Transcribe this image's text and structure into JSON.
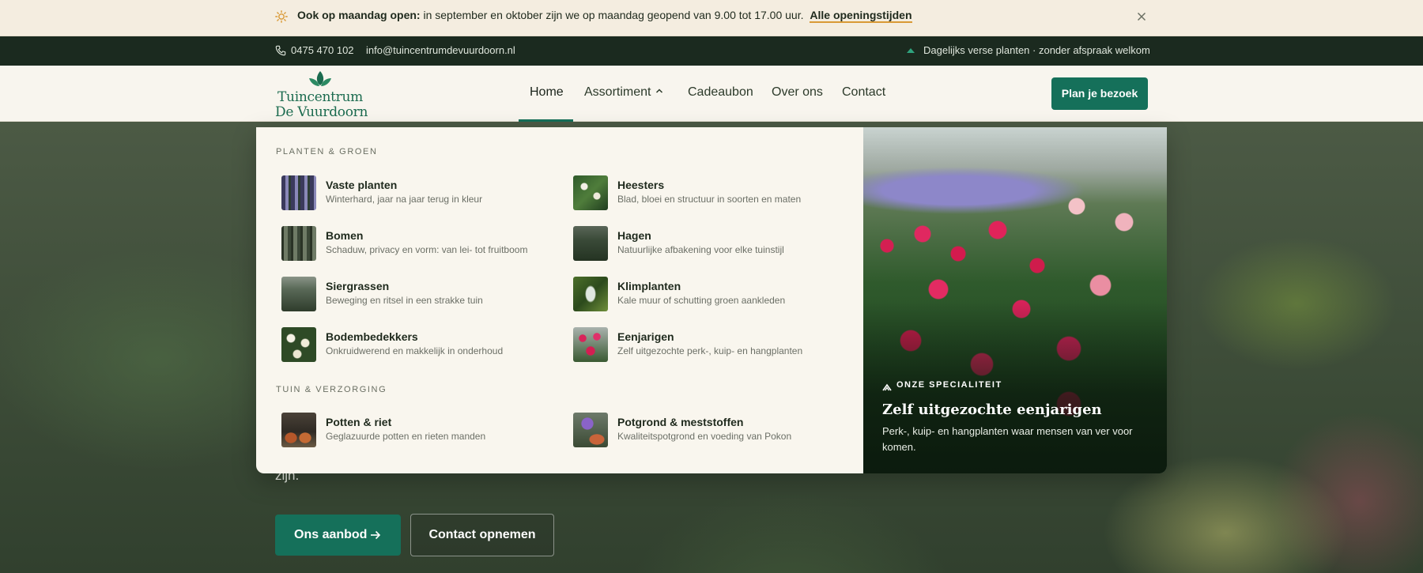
{
  "announcement": {
    "bold": "Ook op maandag open:",
    "text": "in september en oktober zijn we op maandag geopend van 9.00 tot 17.00 uur.",
    "link": "Alle openingstijden",
    "icon": "sun-icon",
    "close_icon": "close-icon"
  },
  "utility": {
    "phone": "0475 470 102",
    "email": "info@tuincentrumdevuurdoorn.nl",
    "tagline": "Dagelijks verse planten · zonder afspraak welkom"
  },
  "logo": {
    "line1": "Tuincentrum",
    "line2": "De Vuurdoorn"
  },
  "nav": {
    "items": [
      {
        "label": "Home",
        "active": true
      },
      {
        "label": "Assortiment",
        "expanded": true
      },
      {
        "label": "Cadeaubon"
      },
      {
        "label": "Over ons"
      },
      {
        "label": "Contact"
      }
    ],
    "cta": "Plan je bezoek"
  },
  "mega_menu": {
    "sections": [
      {
        "title": "Planten & groen",
        "items": [
          {
            "name": "Vaste planten",
            "desc": "Winterhard, jaar na jaar terug in kleur"
          },
          {
            "name": "Heesters",
            "desc": "Blad, bloei en structuur in soorten en maten"
          },
          {
            "name": "Bomen",
            "desc": "Schaduw, privacy en vorm: van lei- tot fruitboom"
          },
          {
            "name": "Hagen",
            "desc": "Natuurlijke afbakening voor elke tuinstijl"
          },
          {
            "name": "Siergrassen",
            "desc": "Beweging en ritsel in een strakke tuin"
          },
          {
            "name": "Klimplanten",
            "desc": "Kale muur of schutting groen aankleden"
          },
          {
            "name": "Bodembedekkers",
            "desc": "Onkruidwerend en makkelijk in onderhoud"
          },
          {
            "name": "Eenjarigen",
            "desc": "Zelf uitgezochte perk-, kuip- en hangplanten"
          }
        ]
      },
      {
        "title": "Tuin & verzorging",
        "items": [
          {
            "name": "Potten & riet",
            "desc": "Geglazuurde potten en rieten manden"
          },
          {
            "name": "Potgrond & meststoffen",
            "desc": "Kwaliteitspotgrond en voeding van Pokon"
          }
        ]
      }
    ],
    "promo": {
      "eyebrow": "Onze specialiteit",
      "title": "Zelf uitgezochte eenjarigen",
      "desc": "Perk-, kuip- en hangplanten waar mensen van ver voor komen."
    }
  },
  "hero": {
    "visible_text_fragment": "zijn.",
    "primary_button": "Ons aanbod",
    "secondary_button": "Contact opnemen"
  },
  "colors": {
    "brand_green": "#15705a",
    "announcement_bg": "#f4ede0",
    "utility_bg": "#1b2a1f",
    "nav_bg": "#f8f5ee",
    "accent_underline": "#d99a36"
  }
}
